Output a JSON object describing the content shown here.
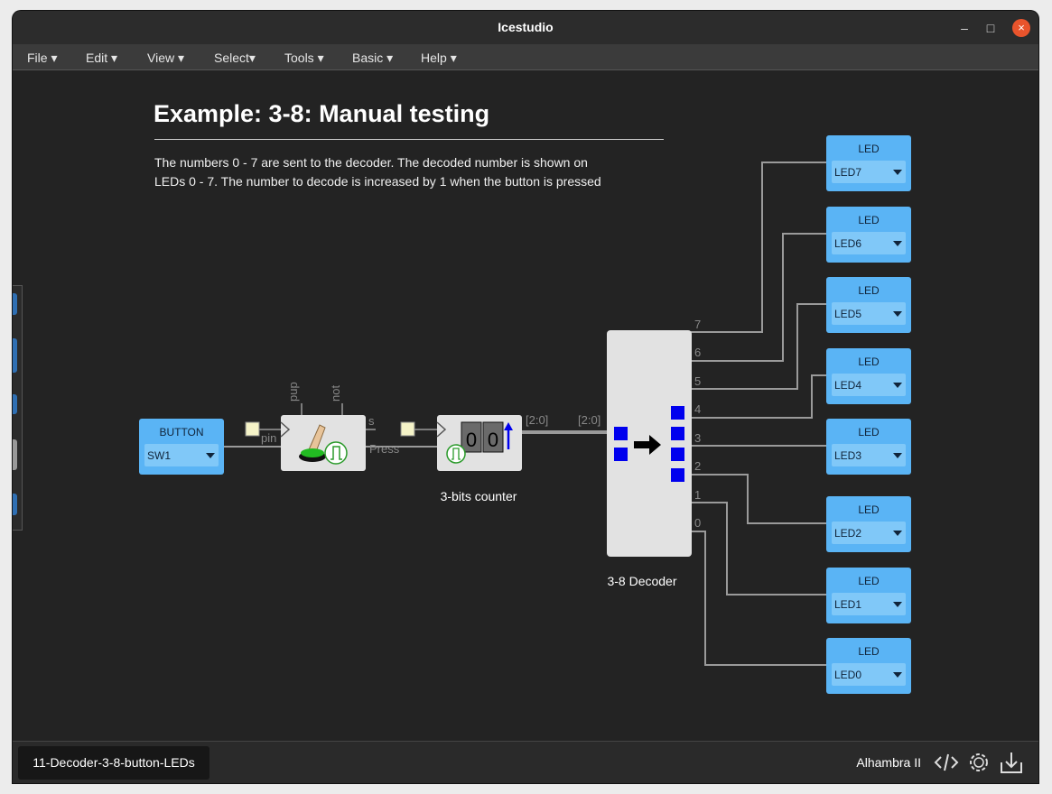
{
  "window": {
    "title": "Icestudio",
    "minimize": "–",
    "maximize": "□",
    "close": "×"
  },
  "menu": {
    "file": "File",
    "edit": "Edit",
    "view": "View",
    "select": "Select",
    "tools": "Tools",
    "basic": "Basic",
    "help": "Help"
  },
  "page": {
    "heading": "Example: 3-8: Manual testing",
    "desc_line1": "The numbers 0 - 7 are sent to the decoder. The decoded number is shown on",
    "desc_line2": "LEDs 0 - 7. The number to decode is increased by 1 when the button is pressed"
  },
  "button_block": {
    "title": "BUTTON",
    "value": "SW1",
    "port_label": "pin"
  },
  "debouncer": {
    "pup": "pup",
    "not": "not",
    "s": "s",
    "out": "Press"
  },
  "counter": {
    "label": "3-bits counter",
    "digit1": "0",
    "digit2": "0",
    "out_bus": "[2:0]"
  },
  "decoder": {
    "label": "3-8 Decoder",
    "in_bus": "[2:0]",
    "outputs": [
      "7",
      "6",
      "5",
      "4",
      "3",
      "2",
      "1",
      "0"
    ]
  },
  "leds": [
    {
      "title": "LED",
      "value": "LED7"
    },
    {
      "title": "LED",
      "value": "LED6"
    },
    {
      "title": "LED",
      "value": "LED5"
    },
    {
      "title": "LED",
      "value": "LED4"
    },
    {
      "title": "LED",
      "value": "LED3"
    },
    {
      "title": "LED",
      "value": "LED2"
    },
    {
      "title": "LED",
      "value": "LED1"
    },
    {
      "title": "LED",
      "value": "LED0"
    }
  ],
  "statusbar": {
    "project": "11-Decoder-3-8-button-LEDs",
    "board": "Alhambra II"
  },
  "colors": {
    "io_block": "#5ab4f5",
    "io_select": "#80c8f8",
    "wire": "#9a9a9a",
    "block_bg": "#e2e2e2",
    "decoder_square": "#0000ee"
  }
}
